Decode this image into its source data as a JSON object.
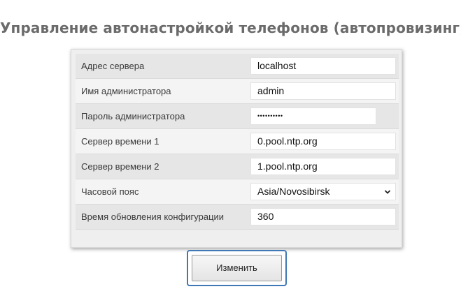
{
  "page": {
    "title": "Управление автонастройкой телефонов (автопровизинг)"
  },
  "settings": {
    "server_address": {
      "label": "Адрес сервера",
      "value": "localhost"
    },
    "admin_name": {
      "label": "Имя администратора",
      "value": "admin"
    },
    "admin_password": {
      "label": "Пароль администратора",
      "value": "••••••••••"
    },
    "time_server_1": {
      "label": "Сервер времени 1",
      "value": "0.pool.ntp.org"
    },
    "time_server_2": {
      "label": "Сервер времени 2",
      "value": "1.pool.ntp.org"
    },
    "timezone": {
      "label": "Часовой пояс",
      "value": "Asia/Novosibirsk"
    },
    "config_refresh": {
      "label": "Время обновления конфигурации",
      "value": "360"
    }
  },
  "actions": {
    "submit_label": "Изменить"
  },
  "icons": {
    "timezone_dropdown": "chevron-down-icon"
  }
}
